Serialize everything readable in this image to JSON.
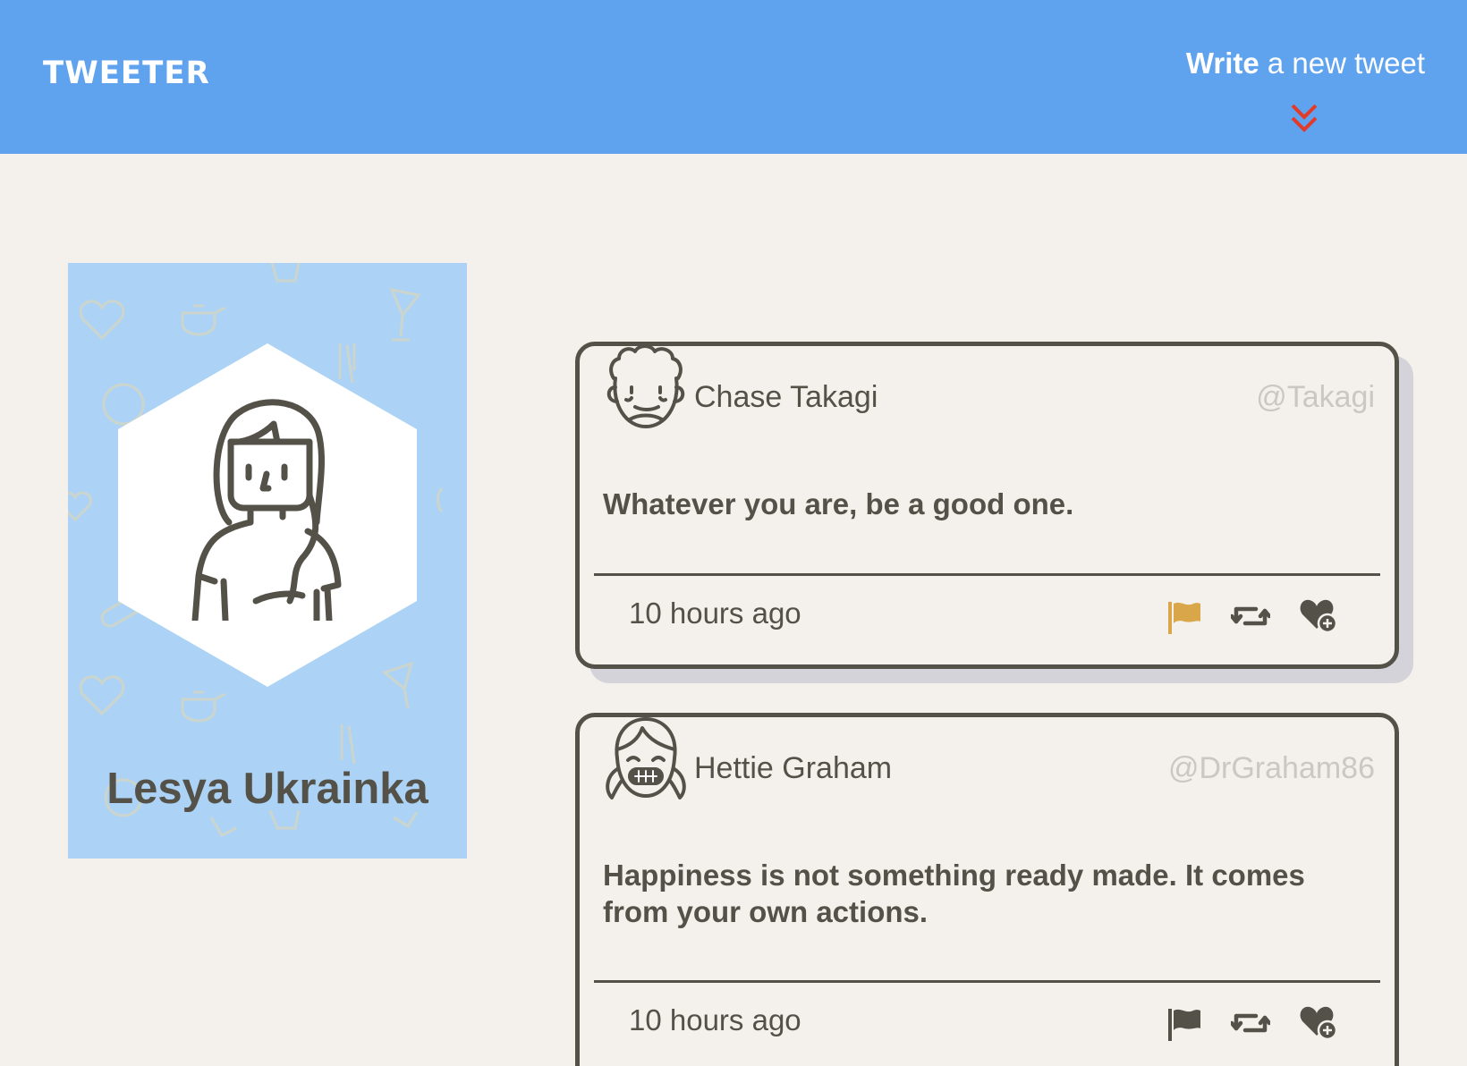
{
  "nav": {
    "logo": "TWEETER",
    "compose_bold": "Write",
    "compose_rest": " a new tweet",
    "toggle_icon": "double-chevron-down-icon",
    "toggle_color": "#e23b2a",
    "bg_color": "#5fa2ee"
  },
  "profile": {
    "name": "Lesya Ukrainka",
    "avatar_icon": "girl-avatar-icon",
    "bg_color": "#acd3f5"
  },
  "tweets": [
    {
      "author": "Chase Takagi",
      "handle": "@Takagi",
      "content": "Whatever you are, be a good one.",
      "time": "10 hours ago",
      "avatar_icon": "curly-hair-man-avatar-icon",
      "flag_color": "#d9a74a"
    },
    {
      "author": "Hettie Graham",
      "handle": "@DrGraham86",
      "content": "Happiness is not something ready made. It comes from your own actions.",
      "time": "10 hours ago",
      "avatar_icon": "smiling-girl-avatar-icon",
      "flag_color": "#545149"
    }
  ],
  "actions": [
    "flag-icon",
    "retweet-icon",
    "like-icon"
  ]
}
